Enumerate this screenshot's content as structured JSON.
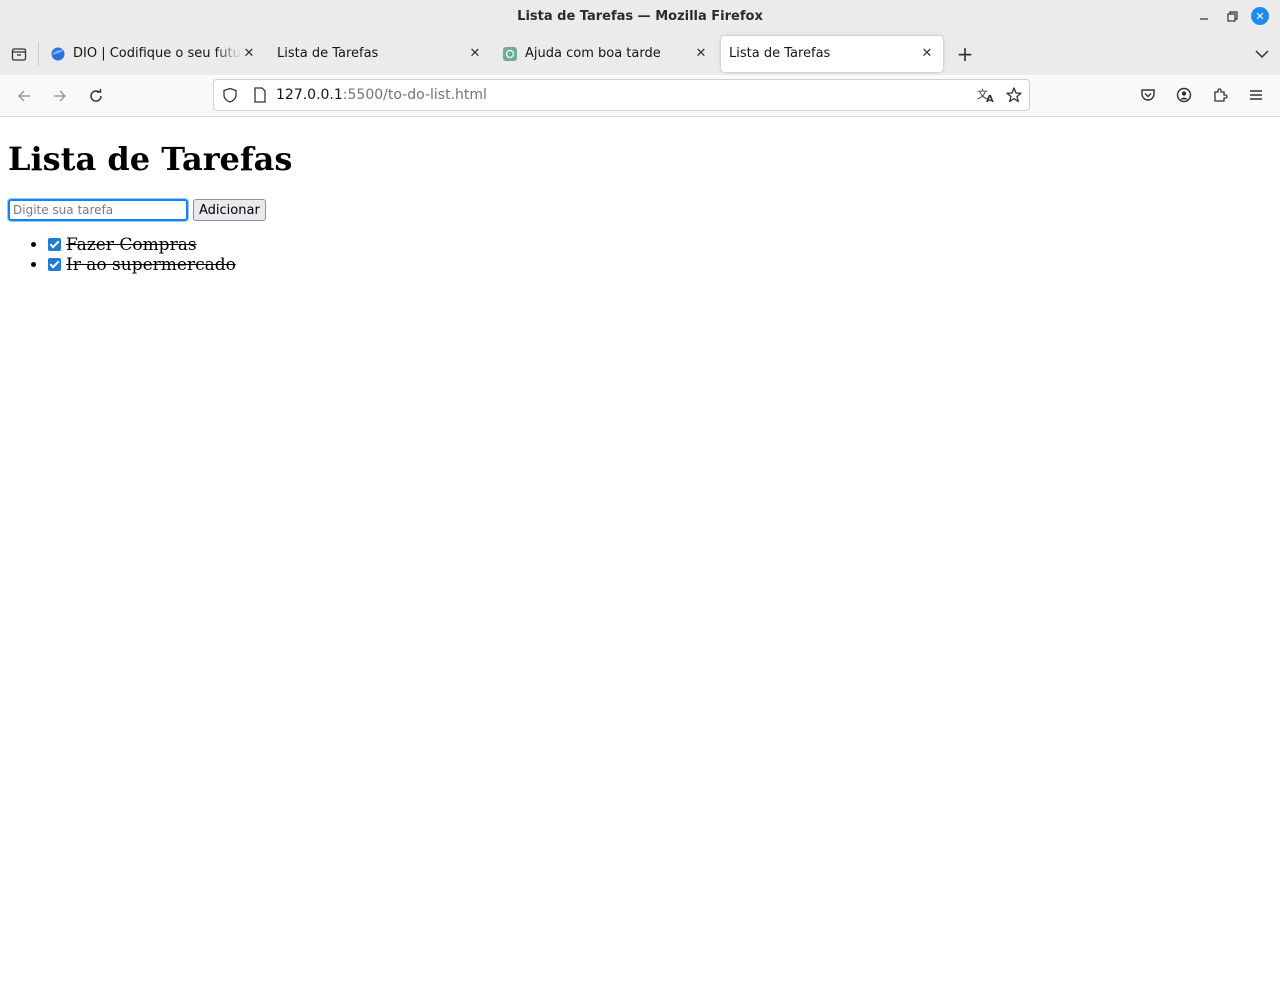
{
  "window": {
    "title": "Lista de Tarefas — Mozilla Firefox"
  },
  "tabs": [
    {
      "label": "DIO | Codifique o seu futuro",
      "favicon": "dio-logo-icon",
      "active": false
    },
    {
      "label": "Lista de Tarefas",
      "favicon": "",
      "active": false
    },
    {
      "label": "Ajuda com boa tarde",
      "favicon": "chatgpt-icon",
      "active": false
    },
    {
      "label": "Lista de Tarefas",
      "favicon": "",
      "active": true
    }
  ],
  "url": {
    "host": "127.0.0.1",
    "rest": ":5500/to-do-list.html"
  },
  "page": {
    "heading": "Lista de Tarefas",
    "input_placeholder": "Digite sua tarefa",
    "add_button": "Adicionar",
    "tasks": [
      {
        "text": "Fazer Compras",
        "done": true
      },
      {
        "text": "Ir ao supermercado",
        "done": true
      }
    ]
  },
  "colors": {
    "accent": "#0a84ff",
    "checkbox": "#1e7bd6"
  }
}
